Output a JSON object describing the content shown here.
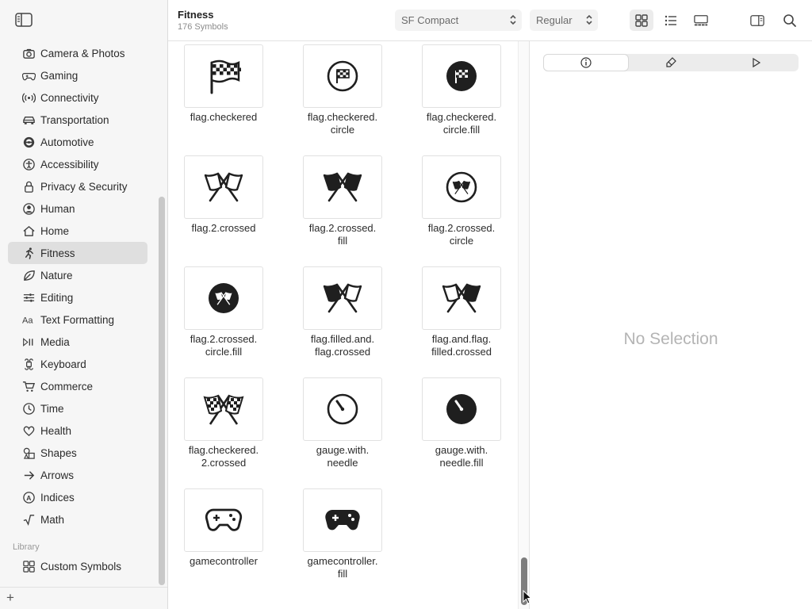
{
  "header": {
    "title": "Fitness",
    "subtitle": "176 Symbols"
  },
  "toolbar": {
    "font_popup": "SF Compact",
    "weight_popup": "Regular"
  },
  "sidebar": {
    "items": [
      {
        "label": "Camera & Photos",
        "icon": "camera-icon"
      },
      {
        "label": "Gaming",
        "icon": "gamecontroller-icon"
      },
      {
        "label": "Connectivity",
        "icon": "antenna-icon"
      },
      {
        "label": "Transportation",
        "icon": "car-icon"
      },
      {
        "label": "Automotive",
        "icon": "steering-wheel-icon"
      },
      {
        "label": "Accessibility",
        "icon": "accessibility-icon"
      },
      {
        "label": "Privacy & Security",
        "icon": "lock-icon"
      },
      {
        "label": "Human",
        "icon": "person-circle-icon"
      },
      {
        "label": "Home",
        "icon": "house-icon"
      },
      {
        "label": "Fitness",
        "icon": "figure-run-icon",
        "selected": true
      },
      {
        "label": "Nature",
        "icon": "leaf-icon"
      },
      {
        "label": "Editing",
        "icon": "slider-icon"
      },
      {
        "label": "Text Formatting",
        "icon": "textformat-icon"
      },
      {
        "label": "Media",
        "icon": "playpause-icon"
      },
      {
        "label": "Keyboard",
        "icon": "command-icon"
      },
      {
        "label": "Commerce",
        "icon": "cart-icon"
      },
      {
        "label": "Time",
        "icon": "clock-icon"
      },
      {
        "label": "Health",
        "icon": "heart-icon"
      },
      {
        "label": "Shapes",
        "icon": "shapes-icon"
      },
      {
        "label": "Arrows",
        "icon": "arrow-icon"
      },
      {
        "label": "Indices",
        "icon": "indices-icon"
      },
      {
        "label": "Math",
        "icon": "sqrt-icon"
      }
    ],
    "library_heading": "Library",
    "library_items": [
      {
        "label": "Custom Symbols",
        "icon": "grid-icon"
      }
    ]
  },
  "symbols": [
    {
      "lines": [
        "flag.checkered"
      ],
      "icon": "flag-checkered-icon"
    },
    {
      "lines": [
        "flag.checkered.",
        "circle"
      ],
      "icon": "flag-checkered-circle-icon"
    },
    {
      "lines": [
        "flag.checkered.",
        "circle.fill"
      ],
      "icon": "flag-checkered-circle-fill-icon"
    },
    {
      "lines": [
        "flag.2.crossed"
      ],
      "icon": "flag-2-crossed-icon"
    },
    {
      "lines": [
        "flag.2.crossed.",
        "fill"
      ],
      "icon": "flag-2-crossed-fill-icon"
    },
    {
      "lines": [
        "flag.2.crossed.",
        "circle"
      ],
      "icon": "flag-2-crossed-circle-icon"
    },
    {
      "lines": [
        "flag.2.crossed.",
        "circle.fill"
      ],
      "icon": "flag-2-crossed-circle-fill-icon"
    },
    {
      "lines": [
        "flag.filled.and.",
        "flag.crossed"
      ],
      "icon": "flag-filled-and-flag-crossed-icon"
    },
    {
      "lines": [
        "flag.and.flag.",
        "filled.crossed"
      ],
      "icon": "flag-and-flag-filled-crossed-icon"
    },
    {
      "lines": [
        "flag.checkered.",
        "2.crossed"
      ],
      "icon": "flag-checkered-2-crossed-icon"
    },
    {
      "lines": [
        "gauge.with.",
        "needle"
      ],
      "icon": "gauge-with-needle-icon"
    },
    {
      "lines": [
        "gauge.with.",
        "needle.fill"
      ],
      "icon": "gauge-with-needle-fill-icon"
    },
    {
      "lines": [
        "gamecontroller"
      ],
      "icon": "gamecontroller-icon"
    },
    {
      "lines": [
        "gamecontroller.",
        "fill"
      ],
      "icon": "gamecontroller-fill-icon"
    }
  ],
  "inspector": {
    "empty_text": "No Selection"
  },
  "colors": {
    "sidebar_bg": "#f6f6f6",
    "selection": "#dfdfdf",
    "text": "#262626",
    "muted": "#8c8c8c"
  }
}
